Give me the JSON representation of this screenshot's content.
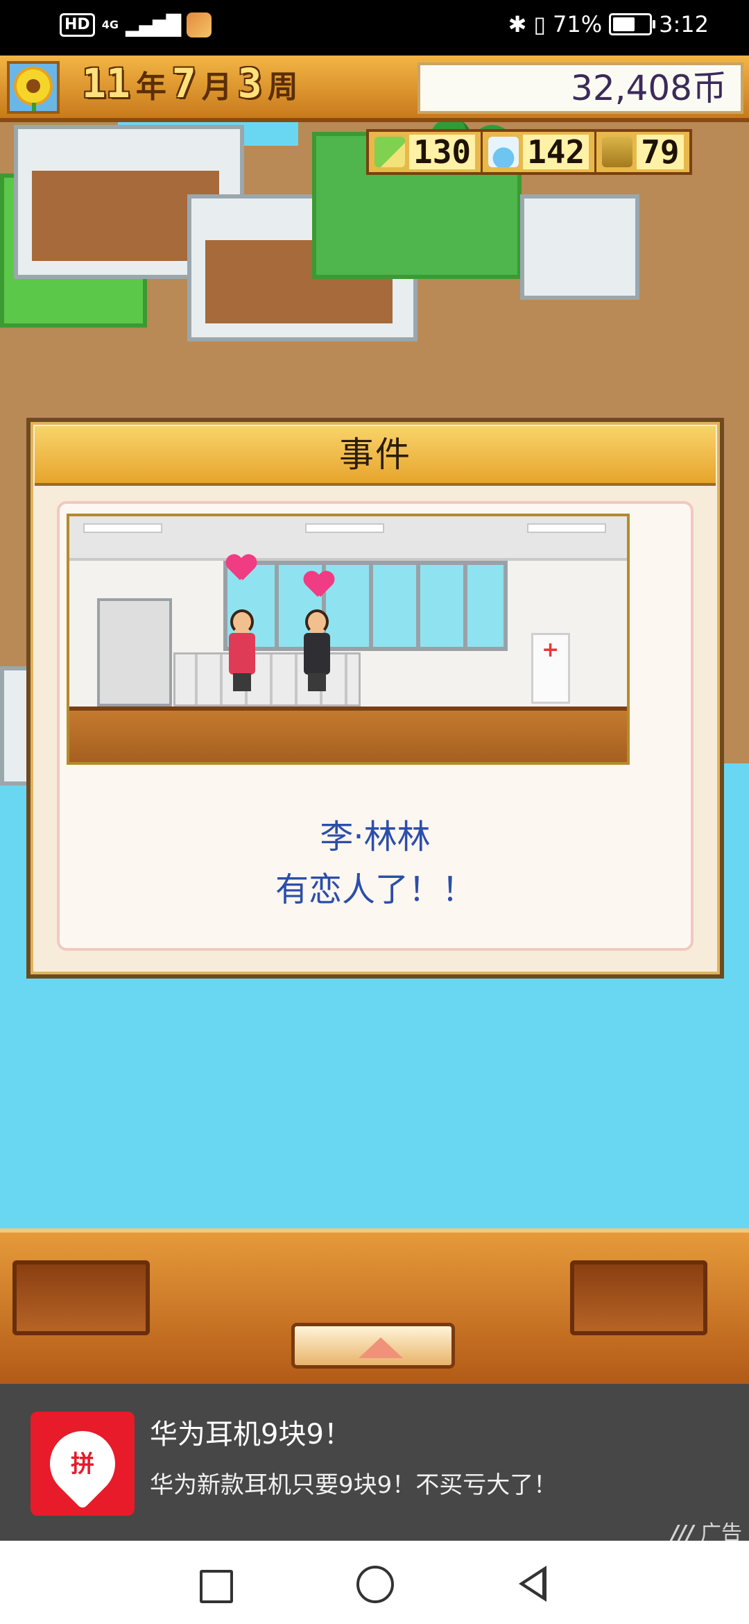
{
  "status_bar": {
    "hd": "HD",
    "network": "4G",
    "battery_percent": "71%",
    "battery_level": 0.71,
    "time": "3:12"
  },
  "game": {
    "date": {
      "year": "11",
      "year_unit": "年",
      "month": "7",
      "month_unit": "月",
      "week": "3",
      "week_unit": "周"
    },
    "money": "32,408币",
    "stats": [
      {
        "icon": "pencil-icon",
        "value": "130"
      },
      {
        "icon": "flask-icon",
        "value": "142"
      },
      {
        "icon": "trophy-icon",
        "value": "79"
      }
    ]
  },
  "event_dialog": {
    "title": "事件",
    "name": "李·林林",
    "message": "有恋人了！！"
  },
  "ad": {
    "title": "华为耳机9块9！",
    "description": "华为新款耳机只要9块9！不买亏大了！",
    "tag": "广告",
    "logo_glyph": "拼"
  }
}
